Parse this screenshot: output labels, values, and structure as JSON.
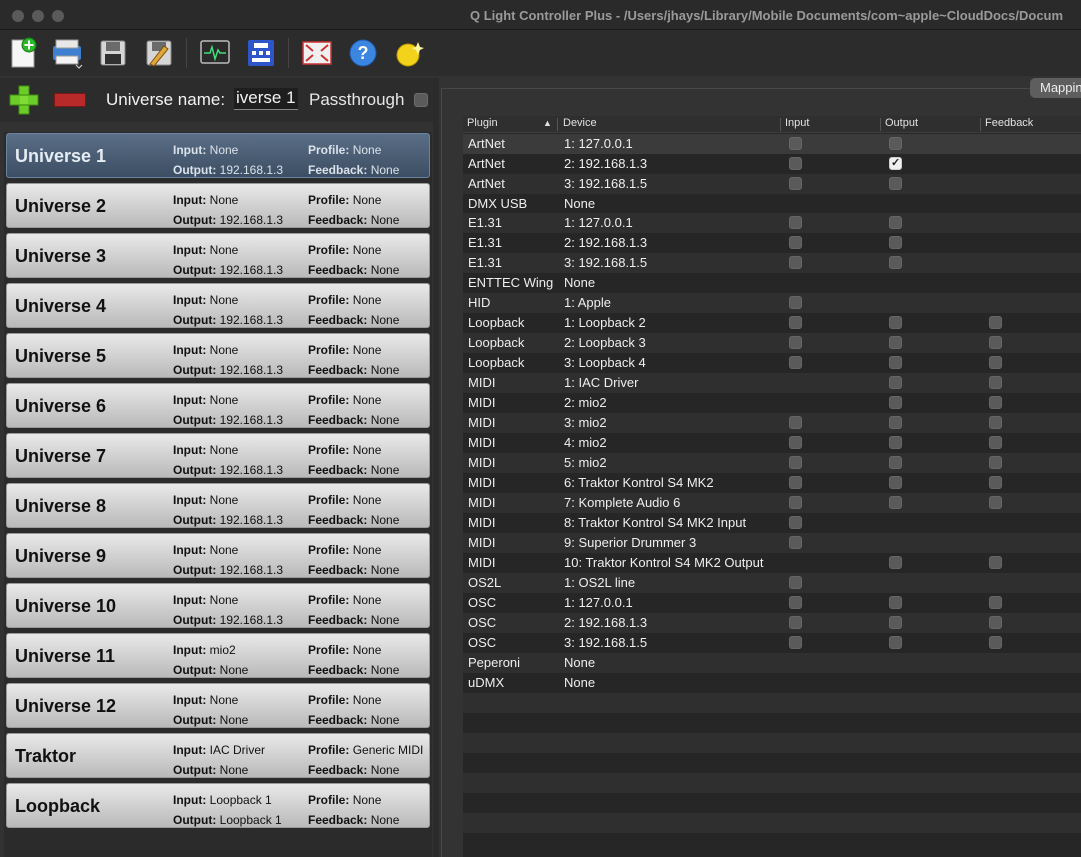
{
  "window": {
    "title": "Q Light Controller Plus - /Users/jhays/Library/Mobile Documents/com~apple~CloudDocs/Docum"
  },
  "toolbar": {
    "buttons": [
      "new-project-icon",
      "open-project-icon",
      "save-icon",
      "save-as-icon",
      "monitor-icon",
      "address-tool-icon",
      "fullscreen-icon",
      "help-icon",
      "about-icon"
    ]
  },
  "universe_editor": {
    "name_label": "Universe name:",
    "name_value": "iverse 1",
    "passthrough_label": "Passthrough"
  },
  "labels": {
    "input": "Input:",
    "output": "Output:",
    "profile": "Profile:",
    "feedback": "Feedback:"
  },
  "universes": [
    {
      "name": "Universe 1",
      "input": "None",
      "output": "192.168.1.3",
      "profile": "None",
      "feedback": "None",
      "selected": true
    },
    {
      "name": "Universe 2",
      "input": "None",
      "output": "192.168.1.3",
      "profile": "None",
      "feedback": "None"
    },
    {
      "name": "Universe 3",
      "input": "None",
      "output": "192.168.1.3",
      "profile": "None",
      "feedback": "None"
    },
    {
      "name": "Universe 4",
      "input": "None",
      "output": "192.168.1.3",
      "profile": "None",
      "feedback": "None"
    },
    {
      "name": "Universe 5",
      "input": "None",
      "output": "192.168.1.3",
      "profile": "None",
      "feedback": "None"
    },
    {
      "name": "Universe 6",
      "input": "None",
      "output": "192.168.1.3",
      "profile": "None",
      "feedback": "None"
    },
    {
      "name": "Universe 7",
      "input": "None",
      "output": "192.168.1.3",
      "profile": "None",
      "feedback": "None"
    },
    {
      "name": "Universe 8",
      "input": "None",
      "output": "192.168.1.3",
      "profile": "None",
      "feedback": "None"
    },
    {
      "name": "Universe 9",
      "input": "None",
      "output": "192.168.1.3",
      "profile": "None",
      "feedback": "None"
    },
    {
      "name": "Universe 10",
      "input": "None",
      "output": "192.168.1.3",
      "profile": "None",
      "feedback": "None"
    },
    {
      "name": "Universe 11",
      "input": "mio2",
      "output": "None",
      "profile": "None",
      "feedback": "None"
    },
    {
      "name": "Universe 12",
      "input": "None",
      "output": "None",
      "profile": "None",
      "feedback": "None"
    },
    {
      "name": "Traktor",
      "input": "IAC Driver",
      "output": "None",
      "profile": "Generic MIDI",
      "feedback": "None"
    },
    {
      "name": "Loopback",
      "input": "Loopback 1",
      "output": "Loopback 1",
      "profile": "None",
      "feedback": "None"
    }
  ],
  "mapping_tab": "Mapping",
  "io_table": {
    "headers": {
      "plugin": "Plugin",
      "device": "Device",
      "input": "Input",
      "output": "Output",
      "feedback": "Feedback"
    },
    "rows": [
      {
        "plugin": "ArtNet",
        "device": "1: 127.0.0.1",
        "input": false,
        "output": false,
        "feedback": null,
        "selected": true
      },
      {
        "plugin": "ArtNet",
        "device": "2: 192.168.1.3",
        "input": false,
        "output": true,
        "feedback": null
      },
      {
        "plugin": "ArtNet",
        "device": "3: 192.168.1.5",
        "input": false,
        "output": false,
        "feedback": null
      },
      {
        "plugin": "DMX USB",
        "device": "None",
        "input": null,
        "output": null,
        "feedback": null
      },
      {
        "plugin": "E1.31",
        "device": "1: 127.0.0.1",
        "input": false,
        "output": false,
        "feedback": null
      },
      {
        "plugin": "E1.31",
        "device": "2: 192.168.1.3",
        "input": false,
        "output": false,
        "feedback": null
      },
      {
        "plugin": "E1.31",
        "device": "3: 192.168.1.5",
        "input": false,
        "output": false,
        "feedback": null
      },
      {
        "plugin": "ENTTEC Wing",
        "device": "None",
        "input": null,
        "output": null,
        "feedback": null
      },
      {
        "plugin": "HID",
        "device": "1: Apple",
        "input": false,
        "output": null,
        "feedback": null
      },
      {
        "plugin": "Loopback",
        "device": "1: Loopback 2",
        "input": false,
        "output": false,
        "feedback": false
      },
      {
        "plugin": "Loopback",
        "device": "2: Loopback 3",
        "input": false,
        "output": false,
        "feedback": false
      },
      {
        "plugin": "Loopback",
        "device": "3: Loopback 4",
        "input": false,
        "output": false,
        "feedback": false
      },
      {
        "plugin": "MIDI",
        "device": "1: IAC Driver",
        "input": null,
        "output": false,
        "feedback": false
      },
      {
        "plugin": "MIDI",
        "device": "2: mio2",
        "input": null,
        "output": false,
        "feedback": false
      },
      {
        "plugin": "MIDI",
        "device": "3: mio2",
        "input": false,
        "output": false,
        "feedback": false
      },
      {
        "plugin": "MIDI",
        "device": "4: mio2",
        "input": false,
        "output": false,
        "feedback": false
      },
      {
        "plugin": "MIDI",
        "device": "5: mio2",
        "input": false,
        "output": false,
        "feedback": false
      },
      {
        "plugin": "MIDI",
        "device": "6: Traktor Kontrol S4 MK2",
        "input": false,
        "output": false,
        "feedback": false
      },
      {
        "plugin": "MIDI",
        "device": "7: Komplete Audio 6",
        "input": false,
        "output": false,
        "feedback": false
      },
      {
        "plugin": "MIDI",
        "device": "8: Traktor Kontrol S4 MK2 Input",
        "input": false,
        "output": null,
        "feedback": null
      },
      {
        "plugin": "MIDI",
        "device": "9: Superior Drummer 3",
        "input": false,
        "output": null,
        "feedback": null
      },
      {
        "plugin": "MIDI",
        "device": "10: Traktor Kontrol S4 MK2 Output",
        "input": null,
        "output": false,
        "feedback": false
      },
      {
        "plugin": "OS2L",
        "device": "1: OS2L line",
        "input": false,
        "output": null,
        "feedback": null
      },
      {
        "plugin": "OSC",
        "device": "1: 127.0.0.1",
        "input": false,
        "output": false,
        "feedback": false
      },
      {
        "plugin": "OSC",
        "device": "2: 192.168.1.3",
        "input": false,
        "output": false,
        "feedback": false
      },
      {
        "plugin": "OSC",
        "device": "3: 192.168.1.5",
        "input": false,
        "output": false,
        "feedback": false
      },
      {
        "plugin": "Peperoni",
        "device": "None",
        "input": null,
        "output": null,
        "feedback": null
      },
      {
        "plugin": "uDMX",
        "device": "None",
        "input": null,
        "output": null,
        "feedback": null
      }
    ]
  }
}
